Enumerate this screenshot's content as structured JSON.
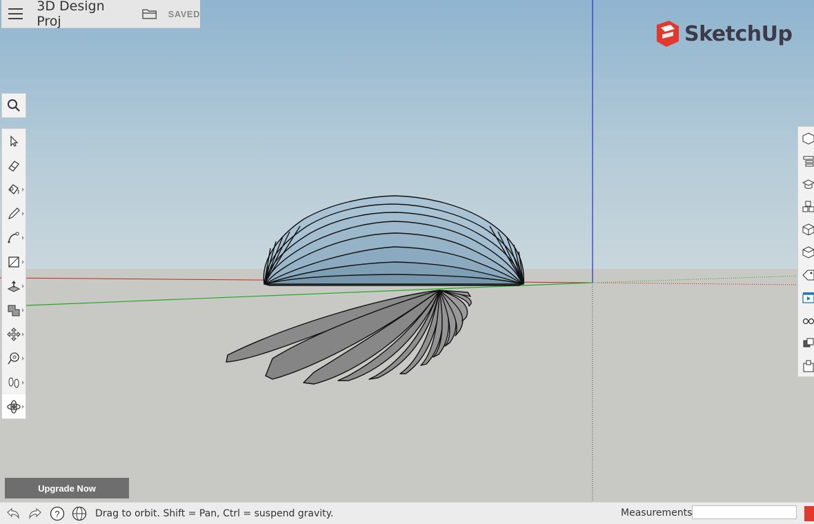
{
  "app": {
    "project_title": "3D Design Proj",
    "save_status": "SAVED",
    "brand": "SketchUp",
    "brand_color": "#e03a2f"
  },
  "header_icons": [
    "menu-icon",
    "folder-icon"
  ],
  "left_toolbar": {
    "search_icon": "search-icon",
    "tools": [
      {
        "name": "select",
        "icon": "arrow-select-icon"
      },
      {
        "name": "eraser",
        "icon": "eraser-icon"
      },
      {
        "name": "paint",
        "icon": "paint-bucket-icon"
      },
      {
        "name": "line",
        "icon": "pencil-icon"
      },
      {
        "name": "arc",
        "icon": "arc-icon"
      },
      {
        "name": "rectangle",
        "icon": "rectangle-icon"
      },
      {
        "name": "push-pull",
        "icon": "push-pull-icon"
      },
      {
        "name": "offset",
        "icon": "offset-icon"
      },
      {
        "name": "move",
        "icon": "move-icon"
      },
      {
        "name": "tape-measure",
        "icon": "tape-measure-icon"
      },
      {
        "name": "walk",
        "icon": "footsteps-icon"
      },
      {
        "name": "orbit",
        "icon": "orbit-icon",
        "active": true
      }
    ]
  },
  "right_panel": {
    "icons": [
      "entity-info-icon",
      "outliner-icon",
      "instructor-icon",
      "components-icon",
      "materials-icon",
      "styles-icon",
      "tags-icon",
      "scenes-icon",
      "display-icon",
      "solid-tools-icon",
      "3d-warehouse-icon"
    ]
  },
  "upgrade": {
    "label": "Upgrade Now"
  },
  "status_bar": {
    "icons": [
      "undo-icon",
      "redo-icon",
      "help-icon",
      "globe-icon"
    ],
    "hint": "Drag to orbit. Shift = Pan, Ctrl = suspend gravity.",
    "measurements_label": "Measurements",
    "measurements_value": ""
  },
  "colors": {
    "sky_top": "#8fb4cf",
    "ground": "#c8c8c4",
    "axis_red": "#cc2222",
    "axis_green": "#22aa22",
    "axis_blue": "#2222cc",
    "model_blue": "#9ab7c9",
    "model_gray": "#8a8a8a"
  }
}
